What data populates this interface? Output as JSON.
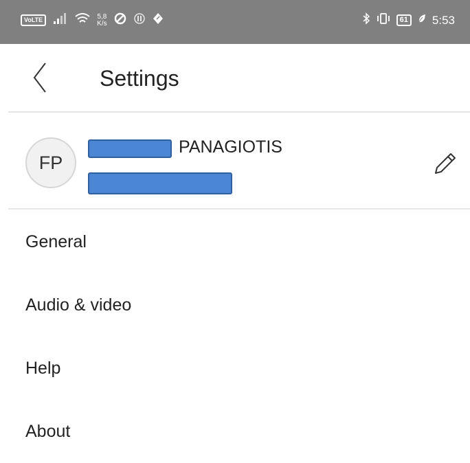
{
  "status_bar": {
    "left_icons": [
      "volte-icon",
      "signal-icon",
      "wifi-icon",
      "network-speed-icon",
      "data-saver-icon",
      "nfc-icon",
      "location-icon"
    ],
    "volte_label": "VoLTE",
    "speed_value": "5,8",
    "speed_unit": "K/s",
    "right_icons": [
      "bluetooth-icon",
      "vibrate-icon",
      "battery-icon",
      "battery-saver-icon"
    ],
    "battery_level": "61",
    "time": "5:53"
  },
  "header": {
    "back_icon": "chevron-left-icon",
    "title": "Settings"
  },
  "profile": {
    "avatar_initials": "FP",
    "name_visible": "PANAGIOTIS",
    "edit_icon": "pencil-icon"
  },
  "menu": {
    "items": [
      {
        "label": "General"
      },
      {
        "label": "Audio & video"
      },
      {
        "label": "Help"
      },
      {
        "label": "About"
      }
    ]
  },
  "colors": {
    "status_bar_bg": "#808080",
    "redaction": "#4a86d4",
    "text": "#222222",
    "divider": "#e6e6e6"
  }
}
